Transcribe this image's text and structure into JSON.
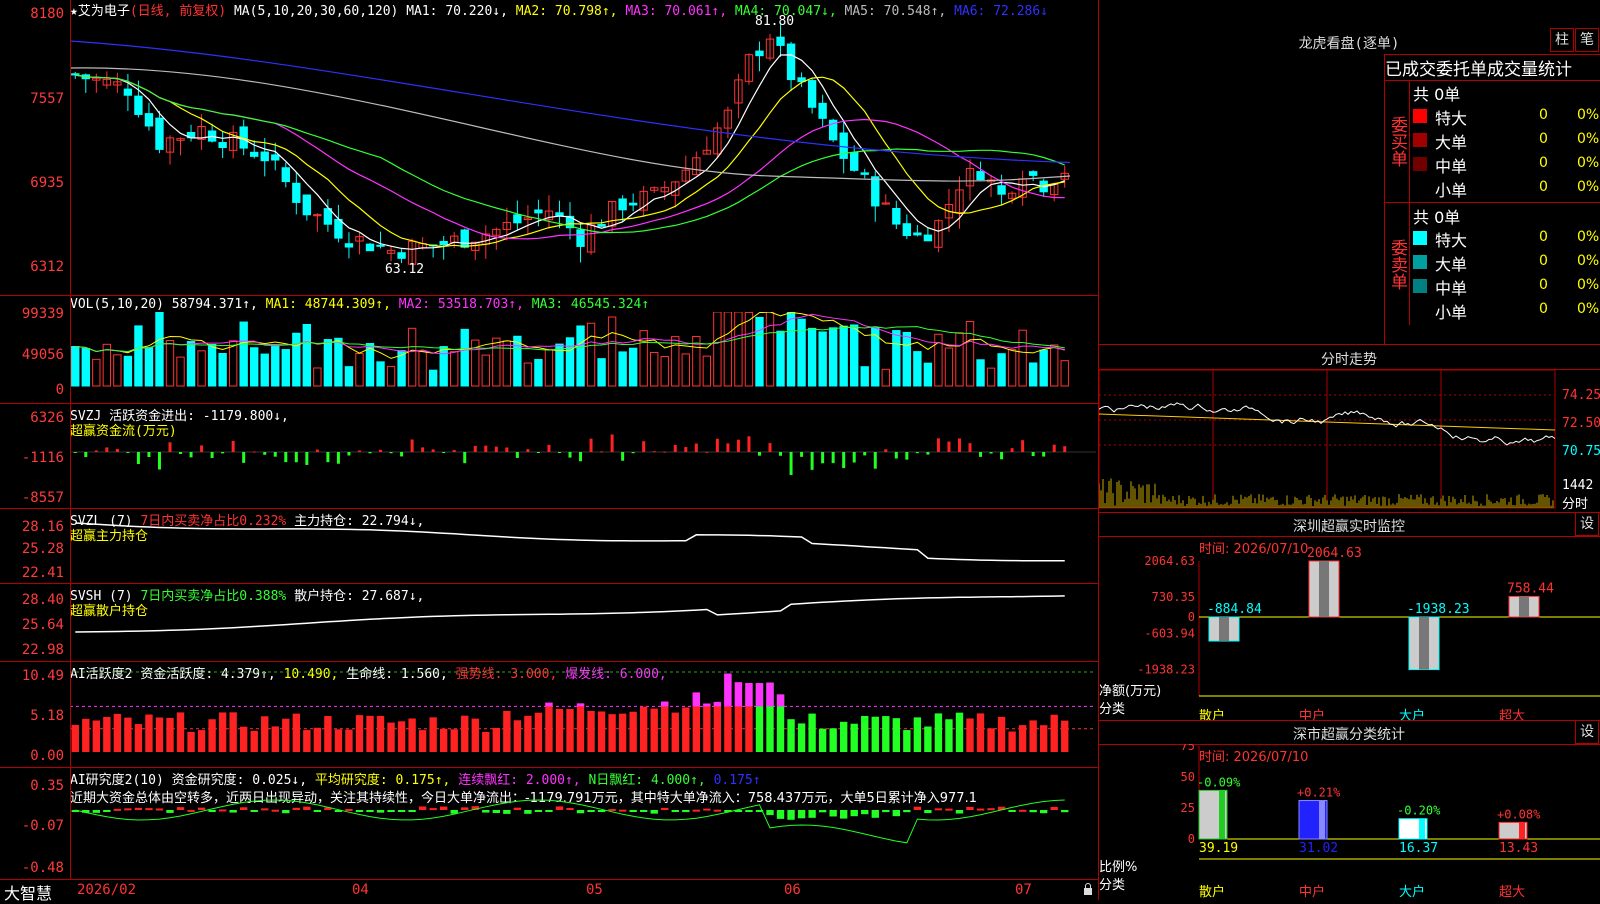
{
  "stock": {
    "name": "艾为电子",
    "mode": "(日线, 前复权)",
    "star": "★"
  },
  "main": {
    "ma_label": "MA(5,10,20,30,60,120)",
    "ma1": "MA1: 70.220↓,",
    "ma2": "MA2: 70.798↑,",
    "ma3": "MA3: 70.061↑,",
    "ma4": "MA4: 70.047↓,",
    "ma5": "MA5: 70.548↑,",
    "ma6": "MA6: 72.286↓",
    "y_ticks": [
      "8180",
      "7557",
      "6935",
      "6312"
    ],
    "high_label": "81.80",
    "low_label": "63.12"
  },
  "vol": {
    "label": "VOL(5,10,20)",
    "value": "58794.371↑,",
    "ma1": "MA1: 48744.309↑,",
    "ma2": "MA2: 53518.703↑,",
    "ma3": "MA3: 46545.324↑",
    "y_ticks": [
      "99339",
      "49056",
      "0"
    ]
  },
  "svzj": {
    "label": "SVZJ",
    "text": "活跃资金进出: -1179.800↓,",
    "sub": "超赢资金流(万元)",
    "y_ticks": [
      "6326",
      "-1116",
      "-8557"
    ]
  },
  "svzl": {
    "label": "SVZL (7)",
    "text1": "7日内买卖净占比0.232%",
    "text2": "主力持仓: 22.794↓,",
    "sub": "超赢主力持仓",
    "y_ticks": [
      "28.16",
      "25.28",
      "22.41"
    ]
  },
  "svsh": {
    "label": "SVSH (7)",
    "text1": "7日内买卖净占比0.388%",
    "text2": "散户持仓: 27.687↓,",
    "sub": "超赢散户持仓",
    "y_ticks": [
      "28.40",
      "25.64",
      "22.98"
    ]
  },
  "ai1": {
    "label": "AI活跃度2",
    "t1": "资金活跃度: 4.379↑,",
    "t2": "10.490,",
    "t3": "生命线: 1.560,",
    "t4": "强势线: 3.000,",
    "t5": "爆发线: 6.000,",
    "y_ticks": [
      "10.49",
      "5.18",
      "0.00"
    ]
  },
  "ai2": {
    "label": "AI研究度2(10)",
    "t1": "资金研究度: 0.025↓,",
    "t2": "平均研究度: 0.175↑,",
    "t3": "连续飘红: 2.000↑,",
    "t4": "N日飘红: 4.000↑,",
    "t5": "0.175↑",
    "desc": "近期大资金总体由空转多，近两日出现异动，关注其持续性，今日大单净流出：-1179.791万元，其中特大单净流入：758.437万元，大单5日累计净入977.1",
    "y_ticks": [
      "0.35",
      "-0.07",
      "-0.48"
    ]
  },
  "xaxis": {
    "brand": "大智慧",
    "labels": [
      "2026/02",
      "04",
      "05",
      "06",
      "07"
    ]
  },
  "dragon": {
    "title": "龙虎看盘(逐单)",
    "btn1": "柱",
    "btn2": "笔",
    "header": "已成交委托单成交量统计",
    "buy_side": "委买单",
    "sell_side": "委卖单",
    "buy_total": "共 0单",
    "sell_total": "共 0单",
    "buy_rows": [
      {
        "label": "特大",
        "count": "0",
        "pct": "0%",
        "color": "#ff0000"
      },
      {
        "label": "大单",
        "count": "0",
        "pct": "0%",
        "color": "#a00000"
      },
      {
        "label": "中单",
        "count": "0",
        "pct": "0%",
        "color": "#700000"
      },
      {
        "label": "小单",
        "count": "0",
        "pct": "0%",
        "color": "#000000"
      }
    ],
    "sell_rows": [
      {
        "label": "特大",
        "count": "0",
        "pct": "0%",
        "color": "#00ffff"
      },
      {
        "label": "大单",
        "count": "0",
        "pct": "0%",
        "color": "#00a0a0"
      },
      {
        "label": "中单",
        "count": "0",
        "pct": "0%",
        "color": "#008080"
      },
      {
        "label": "小单",
        "count": "0",
        "pct": "0%",
        "color": "#000000"
      }
    ]
  },
  "intraday": {
    "title": "分时走势",
    "y_ticks": [
      "74.25",
      "72.50",
      "70.75"
    ],
    "vol_label": "1442",
    "foot": "分时"
  },
  "realtime": {
    "title": "深圳超赢实时监控",
    "btn": "设",
    "time": "时间: 2026/07/10",
    "y_ticks": [
      "2064.63",
      "730.35",
      "0",
      "-603.94",
      "-1938.23"
    ],
    "ylabel1": "净额(万元)",
    "ylabel2": "分类",
    "categories": [
      "散户",
      "中户",
      "大户",
      "超大"
    ],
    "values": [
      -884.84,
      2064.63,
      -1938.23,
      758.44
    ],
    "value_labels": [
      "-884.84",
      "2064.63",
      "-1938.23",
      "758.44"
    ]
  },
  "classify": {
    "title": "深市超赢分类统计",
    "btn": "设",
    "time": "时间: 2026/07/10",
    "y_ticks": [
      "75",
      "50",
      "25",
      "0"
    ],
    "ylabel1": "比例%",
    "ylabel2": "分类",
    "categories": [
      "散户",
      "中户",
      "大户",
      "超大"
    ],
    "values": [
      39.19,
      31.02,
      16.37,
      13.43
    ],
    "value_labels": [
      "39.19",
      "31.02",
      "16.37",
      "13.43"
    ],
    "changes": [
      "-0.09%",
      "+0.21%",
      "-0.20%",
      "+0.08%"
    ]
  }
}
